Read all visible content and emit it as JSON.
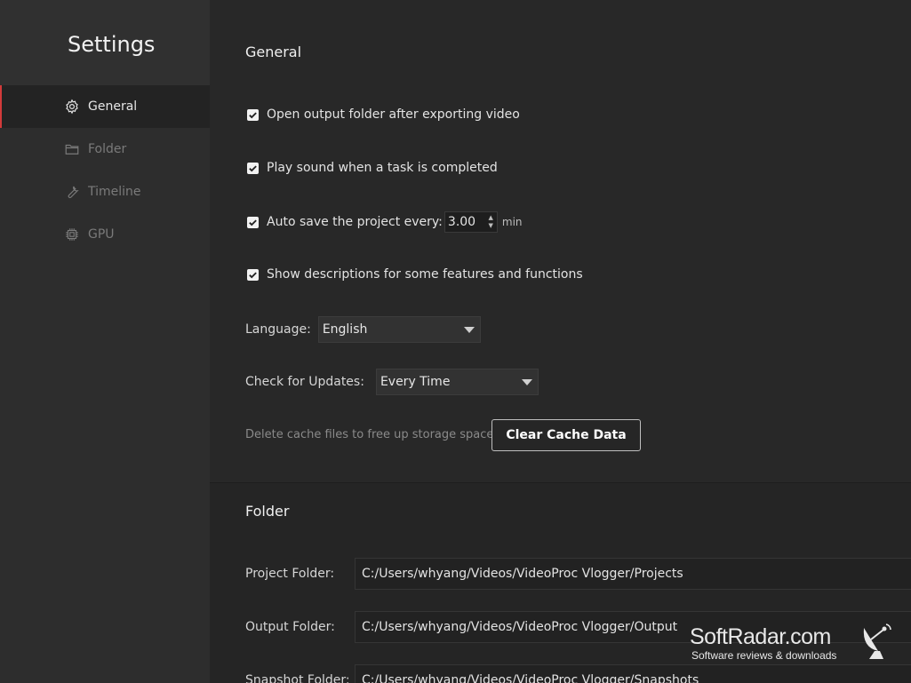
{
  "sidebar": {
    "title": "Settings",
    "items": [
      {
        "label": "General",
        "icon": "gear-icon",
        "active": true
      },
      {
        "label": "Folder",
        "icon": "folder-icon",
        "active": false
      },
      {
        "label": "Timeline",
        "icon": "wrench-icon",
        "active": false
      },
      {
        "label": "GPU",
        "icon": "chip-icon",
        "active": false
      }
    ]
  },
  "general": {
    "title": "General",
    "options": [
      {
        "label": "Open output folder after exporting video",
        "checked": true
      },
      {
        "label": "Play sound when a task is completed",
        "checked": true
      },
      {
        "label": "Auto save the project every:",
        "checked": true
      },
      {
        "label": "Show descriptions for some features and functions",
        "checked": true
      }
    ],
    "autosave_value": "3.00",
    "autosave_unit": "min",
    "language_label": "Language:",
    "language_value": "English",
    "updates_label": "Check for Updates:",
    "updates_value": "Every Time",
    "cache_description": "Delete cache files to free up storage space",
    "clear_cache_button": "Clear Cache Data"
  },
  "folder": {
    "title": "Folder",
    "rows": [
      {
        "label": "Project Folder:",
        "value": "C:/Users/whyang/Videos/VideoProc Vlogger/Projects"
      },
      {
        "label": "Output Folder:",
        "value": "C:/Users/whyang/Videos/VideoProc Vlogger/Output"
      },
      {
        "label": "Snapshot Folder:",
        "value": "C:/Users/whyang/Videos/VideoProc Vlogger/Snapshots"
      }
    ]
  },
  "watermark": {
    "main": "SoftRadar.com",
    "sub": "Software reviews & downloads"
  },
  "colors": {
    "accent": "#d33a3a",
    "background": "#262626",
    "sidebar": "#2d2d2d"
  }
}
